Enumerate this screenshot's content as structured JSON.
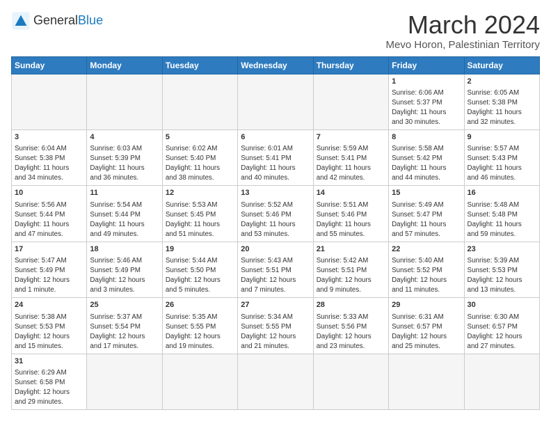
{
  "header": {
    "logo_general": "General",
    "logo_blue": "Blue",
    "month_title": "March 2024",
    "location": "Mevo Horon, Palestinian Territory"
  },
  "weekdays": [
    "Sunday",
    "Monday",
    "Tuesday",
    "Wednesday",
    "Thursday",
    "Friday",
    "Saturday"
  ],
  "weeks": [
    [
      {
        "day": "",
        "info": ""
      },
      {
        "day": "",
        "info": ""
      },
      {
        "day": "",
        "info": ""
      },
      {
        "day": "",
        "info": ""
      },
      {
        "day": "",
        "info": ""
      },
      {
        "day": "1",
        "info": "Sunrise: 6:06 AM\nSunset: 5:37 PM\nDaylight: 11 hours\nand 30 minutes."
      },
      {
        "day": "2",
        "info": "Sunrise: 6:05 AM\nSunset: 5:38 PM\nDaylight: 11 hours\nand 32 minutes."
      }
    ],
    [
      {
        "day": "3",
        "info": "Sunrise: 6:04 AM\nSunset: 5:38 PM\nDaylight: 11 hours\nand 34 minutes."
      },
      {
        "day": "4",
        "info": "Sunrise: 6:03 AM\nSunset: 5:39 PM\nDaylight: 11 hours\nand 36 minutes."
      },
      {
        "day": "5",
        "info": "Sunrise: 6:02 AM\nSunset: 5:40 PM\nDaylight: 11 hours\nand 38 minutes."
      },
      {
        "day": "6",
        "info": "Sunrise: 6:01 AM\nSunset: 5:41 PM\nDaylight: 11 hours\nand 40 minutes."
      },
      {
        "day": "7",
        "info": "Sunrise: 5:59 AM\nSunset: 5:41 PM\nDaylight: 11 hours\nand 42 minutes."
      },
      {
        "day": "8",
        "info": "Sunrise: 5:58 AM\nSunset: 5:42 PM\nDaylight: 11 hours\nand 44 minutes."
      },
      {
        "day": "9",
        "info": "Sunrise: 5:57 AM\nSunset: 5:43 PM\nDaylight: 11 hours\nand 46 minutes."
      }
    ],
    [
      {
        "day": "10",
        "info": "Sunrise: 5:56 AM\nSunset: 5:44 PM\nDaylight: 11 hours\nand 47 minutes."
      },
      {
        "day": "11",
        "info": "Sunrise: 5:54 AM\nSunset: 5:44 PM\nDaylight: 11 hours\nand 49 minutes."
      },
      {
        "day": "12",
        "info": "Sunrise: 5:53 AM\nSunset: 5:45 PM\nDaylight: 11 hours\nand 51 minutes."
      },
      {
        "day": "13",
        "info": "Sunrise: 5:52 AM\nSunset: 5:46 PM\nDaylight: 11 hours\nand 53 minutes."
      },
      {
        "day": "14",
        "info": "Sunrise: 5:51 AM\nSunset: 5:46 PM\nDaylight: 11 hours\nand 55 minutes."
      },
      {
        "day": "15",
        "info": "Sunrise: 5:49 AM\nSunset: 5:47 PM\nDaylight: 11 hours\nand 57 minutes."
      },
      {
        "day": "16",
        "info": "Sunrise: 5:48 AM\nSunset: 5:48 PM\nDaylight: 11 hours\nand 59 minutes."
      }
    ],
    [
      {
        "day": "17",
        "info": "Sunrise: 5:47 AM\nSunset: 5:49 PM\nDaylight: 12 hours\nand 1 minute."
      },
      {
        "day": "18",
        "info": "Sunrise: 5:46 AM\nSunset: 5:49 PM\nDaylight: 12 hours\nand 3 minutes."
      },
      {
        "day": "19",
        "info": "Sunrise: 5:44 AM\nSunset: 5:50 PM\nDaylight: 12 hours\nand 5 minutes."
      },
      {
        "day": "20",
        "info": "Sunrise: 5:43 AM\nSunset: 5:51 PM\nDaylight: 12 hours\nand 7 minutes."
      },
      {
        "day": "21",
        "info": "Sunrise: 5:42 AM\nSunset: 5:51 PM\nDaylight: 12 hours\nand 9 minutes."
      },
      {
        "day": "22",
        "info": "Sunrise: 5:40 AM\nSunset: 5:52 PM\nDaylight: 12 hours\nand 11 minutes."
      },
      {
        "day": "23",
        "info": "Sunrise: 5:39 AM\nSunset: 5:53 PM\nDaylight: 12 hours\nand 13 minutes."
      }
    ],
    [
      {
        "day": "24",
        "info": "Sunrise: 5:38 AM\nSunset: 5:53 PM\nDaylight: 12 hours\nand 15 minutes."
      },
      {
        "day": "25",
        "info": "Sunrise: 5:37 AM\nSunset: 5:54 PM\nDaylight: 12 hours\nand 17 minutes."
      },
      {
        "day": "26",
        "info": "Sunrise: 5:35 AM\nSunset: 5:55 PM\nDaylight: 12 hours\nand 19 minutes."
      },
      {
        "day": "27",
        "info": "Sunrise: 5:34 AM\nSunset: 5:55 PM\nDaylight: 12 hours\nand 21 minutes."
      },
      {
        "day": "28",
        "info": "Sunrise: 5:33 AM\nSunset: 5:56 PM\nDaylight: 12 hours\nand 23 minutes."
      },
      {
        "day": "29",
        "info": "Sunrise: 6:31 AM\nSunset: 6:57 PM\nDaylight: 12 hours\nand 25 minutes."
      },
      {
        "day": "30",
        "info": "Sunrise: 6:30 AM\nSunset: 6:57 PM\nDaylight: 12 hours\nand 27 minutes."
      }
    ],
    [
      {
        "day": "31",
        "info": "Sunrise: 6:29 AM\nSunset: 6:58 PM\nDaylight: 12 hours\nand 29 minutes."
      },
      {
        "day": "",
        "info": ""
      },
      {
        "day": "",
        "info": ""
      },
      {
        "day": "",
        "info": ""
      },
      {
        "day": "",
        "info": ""
      },
      {
        "day": "",
        "info": ""
      },
      {
        "day": "",
        "info": ""
      }
    ]
  ]
}
